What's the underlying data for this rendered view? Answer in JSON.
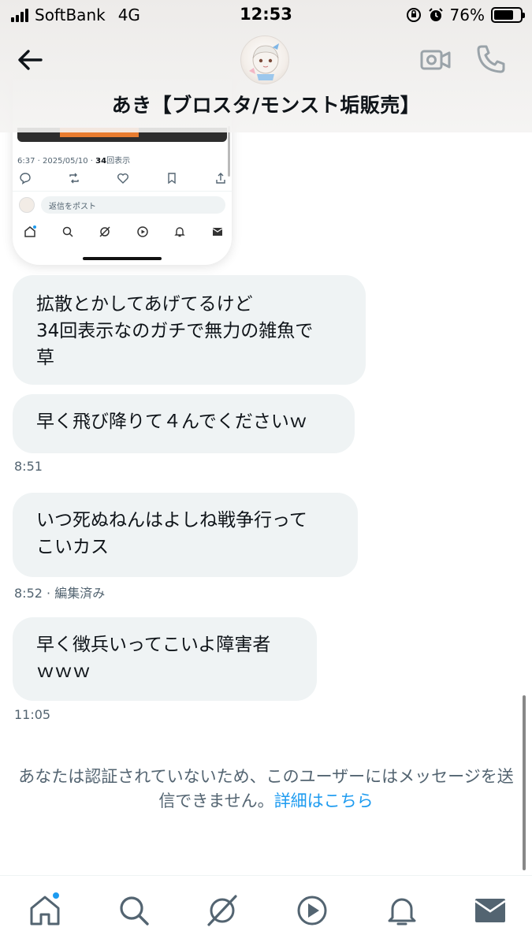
{
  "status_bar": {
    "carrier": "SoftBank",
    "network": "4G",
    "time": "12:53",
    "battery_percent": "76%",
    "battery_level": 0.76
  },
  "header": {
    "title": "あき【ブロスタ/モンスト垢販売】",
    "back_icon": "arrow-left-icon",
    "video_icon": "video-call-icon",
    "call_icon": "phone-icon"
  },
  "shared_post": {
    "meta_prefix": "6:37 · 2025/05/10 · ",
    "views_count": "34",
    "views_suffix": "回表示",
    "reply_placeholder": "返信をポスト"
  },
  "messages": [
    {
      "text": "拡散とかしてあげてるけど\n34回表示なのガチで無力の雑魚で\n草"
    },
    {
      "text": "早く飛び降りて４んでくださいｗ",
      "timestamp": "8:51"
    },
    {
      "text": "いつ死ぬねんはよしね戦争行って\nこいカス",
      "timestamp": "8:52 · 編集済み"
    },
    {
      "text": "早く徴兵いってこいよ障害者\nｗｗｗ",
      "timestamp": "11:05"
    }
  ],
  "notice": {
    "text": "あなたは認証されていないため、このユーザーにはメッセージを送信できません。",
    "link": "詳細はこちら"
  },
  "bottom_nav": {
    "items": [
      "home-icon",
      "search-icon",
      "grok-icon",
      "video-icon",
      "notifications-icon",
      "messages-icon"
    ],
    "home_has_badge": true
  },
  "colors": {
    "accent": "#1d9bf0",
    "bubble": "#eff3f4",
    "secondary_text": "#536471"
  }
}
